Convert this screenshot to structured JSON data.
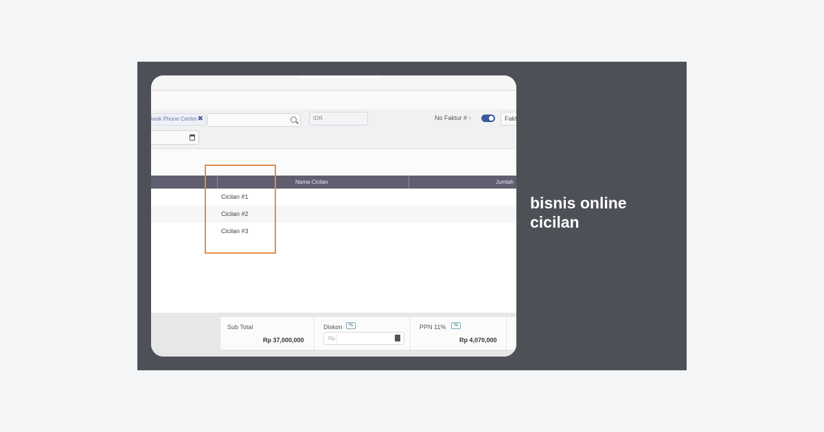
{
  "caption": {
    "title": "bisnis online cicilan"
  },
  "filters": {
    "chip_label": "Iwak Phone Center",
    "chip_remove": "✖",
    "currency": "IDR",
    "nofaktur_label": "No Faktur # ◦",
    "faktur_value": "Fakt"
  },
  "table": {
    "headers": [
      "Nama Cicilan",
      "Jumlah"
    ],
    "rows": [
      "Cicilan #1",
      "Cicilan #2",
      "Cicilan #3"
    ]
  },
  "totals": {
    "subtotal_label": "Sub Total",
    "subtotal_value": "Rp 37,000,000",
    "diskon_label": "Diskon",
    "diskon_pct": "%",
    "diskon_prefix": "Rp",
    "ppn_label": "PPN 11%",
    "ppn_pct": "%",
    "ppn_value": "Rp 4,070,000"
  },
  "colors": {
    "card_bg": "#4d5057",
    "table_header": "#5f5f70",
    "highlight_border": "#e38b45",
    "toggle": "#3c5a99"
  }
}
